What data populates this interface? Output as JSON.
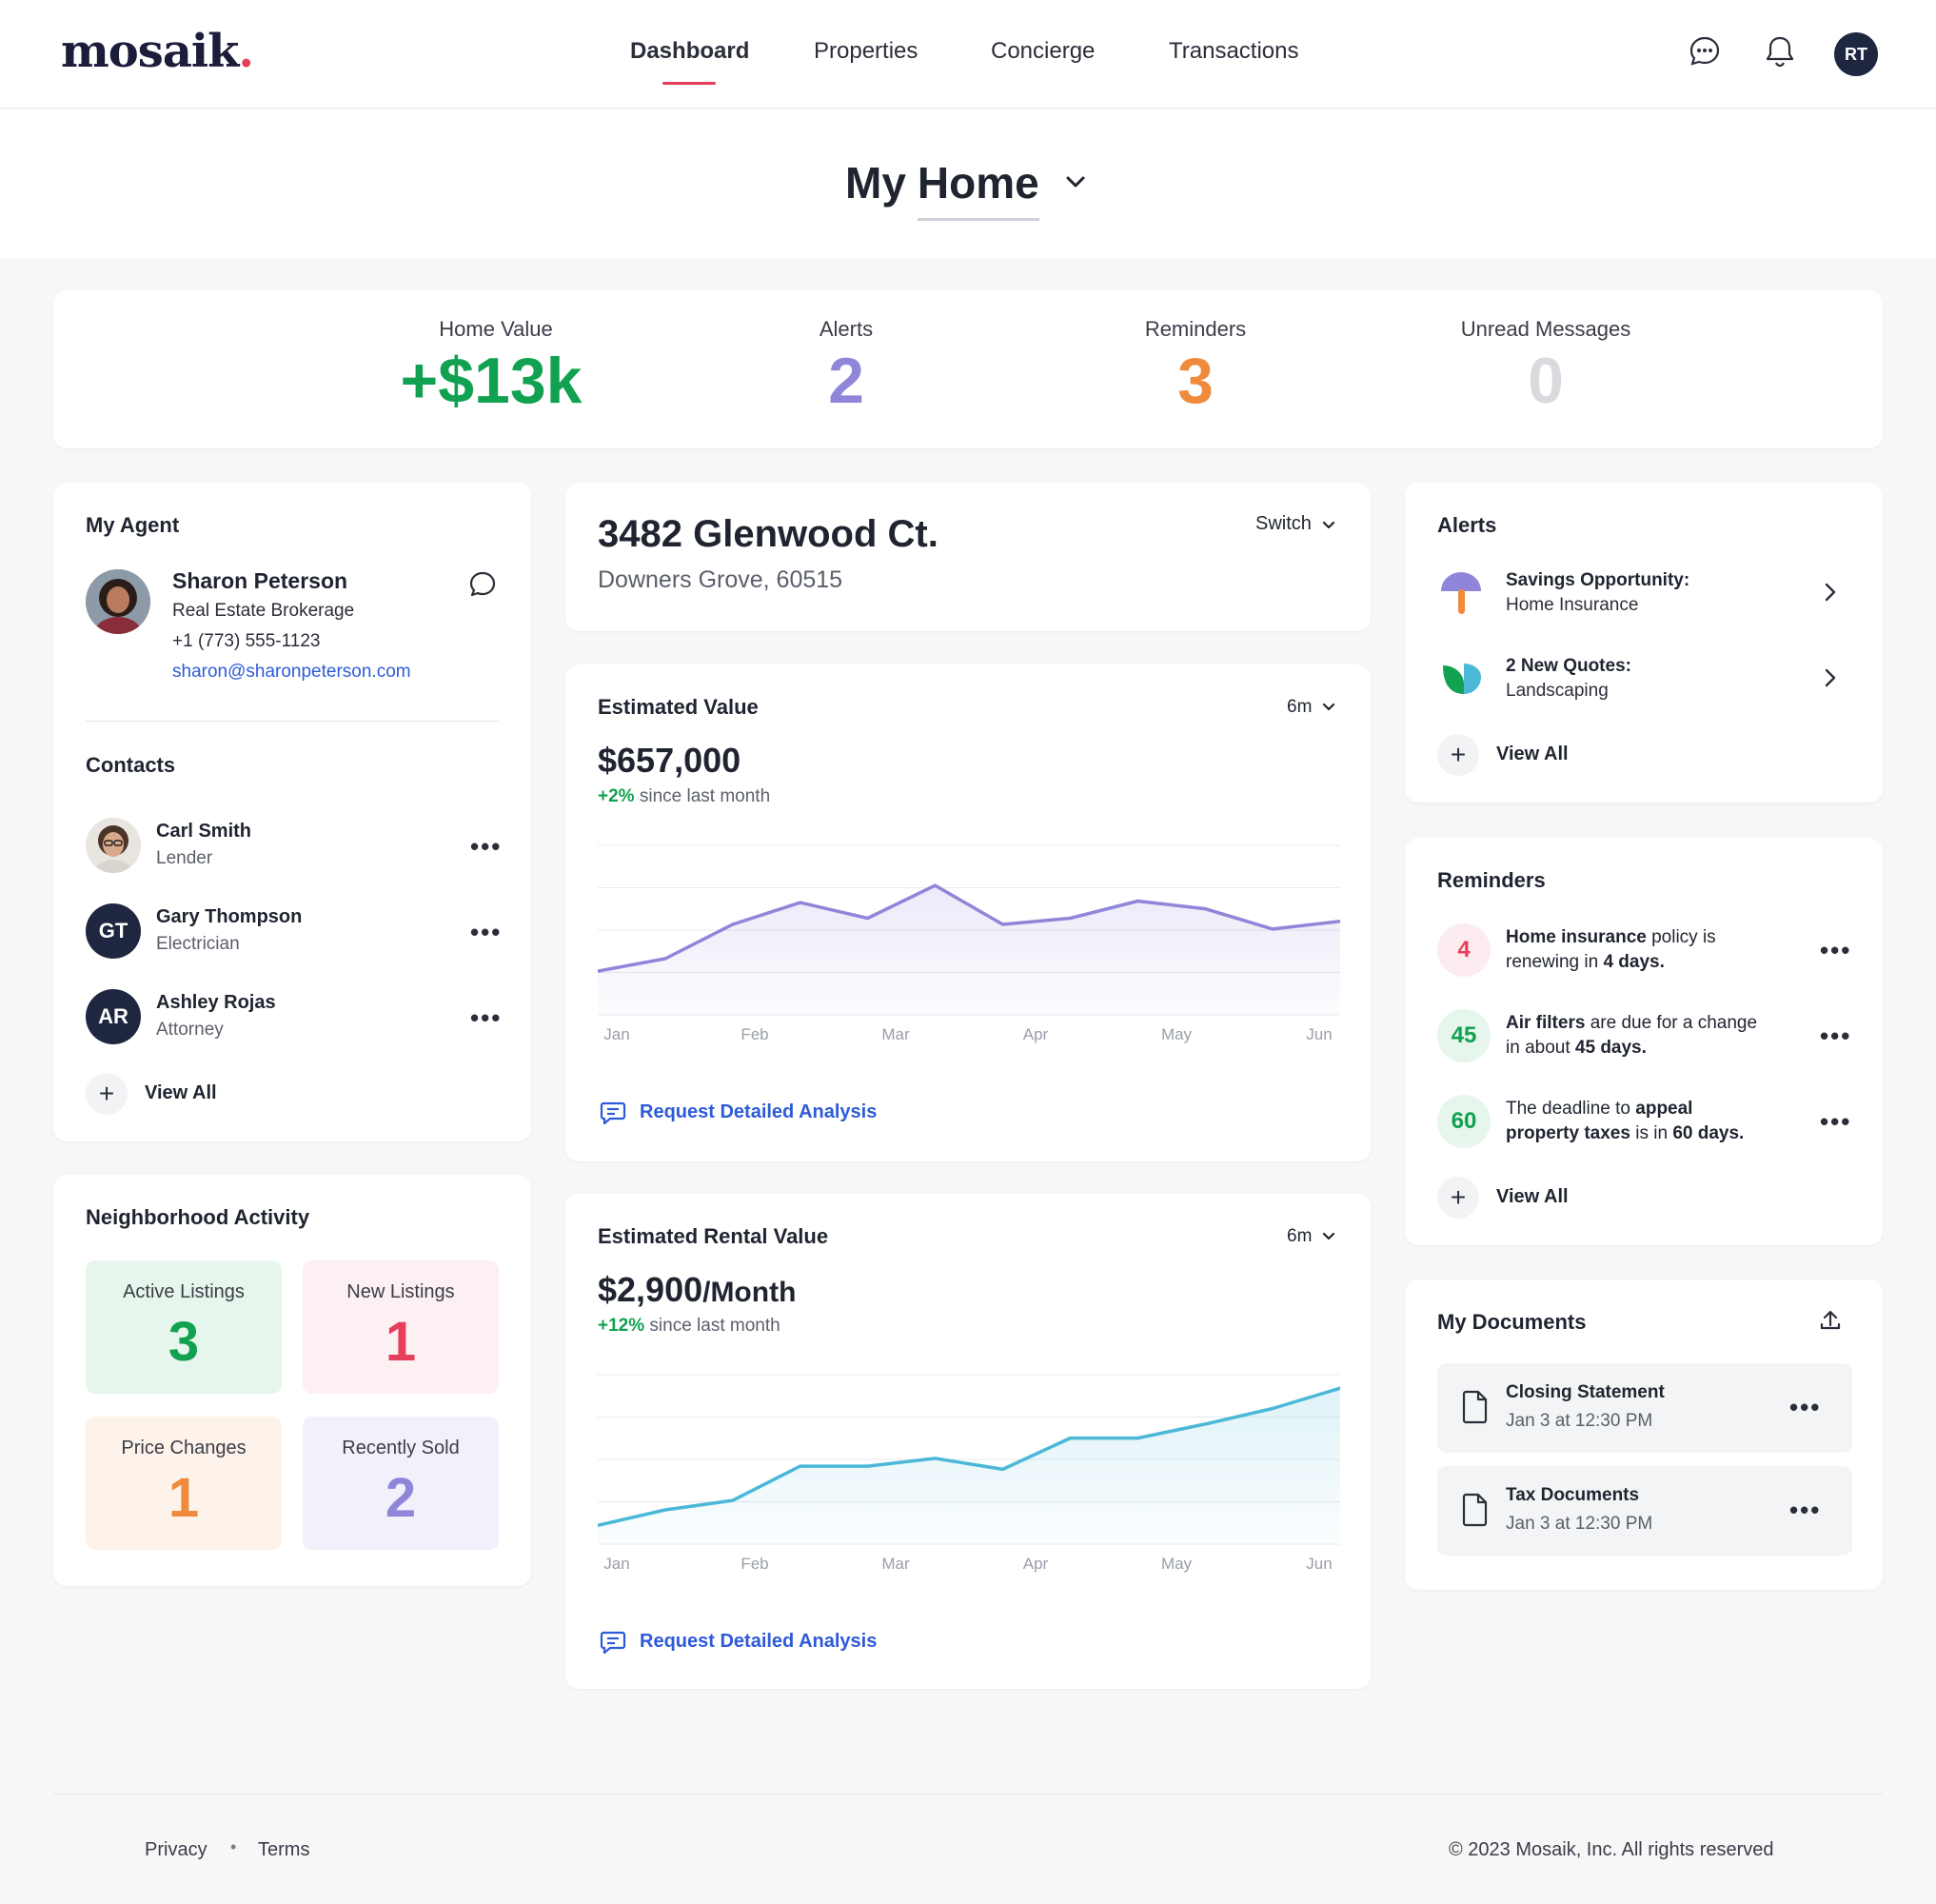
{
  "header": {
    "logo": "mosaik",
    "nav": [
      "Dashboard",
      "Properties",
      "Concierge",
      "Transactions"
    ],
    "active_nav": "Dashboard",
    "user_initials": "RT"
  },
  "page": {
    "title_prefix": "My",
    "title_selected": "Home"
  },
  "summary": [
    {
      "label": "Home Value",
      "value": "+$13k",
      "color": "#12a150"
    },
    {
      "label": "Alerts",
      "value": "2",
      "color": "#8f86d9"
    },
    {
      "label": "Reminders",
      "value": "3",
      "color": "#f08a3c"
    },
    {
      "label": "Unread Messages",
      "value": "0",
      "color": "#d9dade"
    }
  ],
  "agent": {
    "section_title": "My Agent",
    "name": "Sharon Peterson",
    "company": "Real Estate Brokerage",
    "phone": "+1 (773) 555-1123",
    "email": "sharon@sharonpeterson.com"
  },
  "contacts": {
    "section_title": "Contacts",
    "items": [
      {
        "name": "Carl Smith",
        "role": "Lender",
        "initials": ""
      },
      {
        "name": "Gary Thompson",
        "role": "Electrician",
        "initials": "GT"
      },
      {
        "name": "Ashley Rojas",
        "role": "Attorney",
        "initials": "AR"
      }
    ],
    "view_all": "View All"
  },
  "neighborhood": {
    "title": "Neighborhood Activity",
    "tiles": [
      {
        "label": "Active Listings",
        "value": "3",
        "bg": "#e6f6ec",
        "color": "#12a150"
      },
      {
        "label": "New Listings",
        "value": "1",
        "bg": "#fdf0f2",
        "color": "#e63e5b"
      },
      {
        "label": "Price Changes",
        "value": "1",
        "bg": "#fdf3ea",
        "color": "#f08a3c"
      },
      {
        "label": "Recently Sold",
        "value": "2",
        "bg": "#f1f0fb",
        "color": "#8f86d9"
      }
    ]
  },
  "property": {
    "address": "3482 Glenwood Ct.",
    "city": "Downers Grove, 60515",
    "switch_label": "Switch"
  },
  "estimated_value": {
    "title": "Estimated Value",
    "range": "6m",
    "value": "$657,000",
    "change": "+2%",
    "change_suffix": "since last month",
    "action": "Request Detailed Analysis"
  },
  "estimated_rental": {
    "title": "Estimated Rental Value",
    "range": "6m",
    "value": "$2,900",
    "value_suffix": "/Month",
    "change": "+12%",
    "change_suffix": "since last month",
    "action": "Request Detailed Analysis"
  },
  "chart_data": [
    {
      "type": "area",
      "x": [
        "Jan",
        "Feb",
        "Mar",
        "Apr",
        "May",
        "Jun"
      ],
      "series": [
        {
          "values": [
            0.28,
            0.36,
            0.58,
            0.72,
            0.62,
            0.83,
            0.58,
            0.62,
            0.73,
            0.68,
            0.55,
            0.6
          ]
        }
      ],
      "color": "#8f86d9",
      "grid": true
    },
    {
      "type": "area",
      "x": [
        "Jan",
        "Feb",
        "Mar",
        "Apr",
        "May",
        "Jun"
      ],
      "series": [
        {
          "values": [
            0.12,
            0.22,
            0.28,
            0.5,
            0.5,
            0.55,
            0.48,
            0.68,
            0.68,
            0.77,
            0.87,
            1.0
          ]
        }
      ],
      "color": "#4bb8d8",
      "grid": true
    }
  ],
  "alerts": {
    "title": "Alerts",
    "items": [
      {
        "title": "Savings Opportunity:",
        "subtitle": "Home Insurance",
        "icon": "umbrella-icon"
      },
      {
        "title": "2 New Quotes:",
        "subtitle": "Landscaping",
        "icon": "leaf-icon"
      }
    ],
    "view_all": "View All"
  },
  "reminders": {
    "title": "Reminders",
    "items": [
      {
        "badge": "4",
        "badge_bg": "#fdecef",
        "badge_color": "#e63e5b",
        "a": "Home insurance",
        "b": " policy is",
        "c": "renewing in ",
        "d": "4 days."
      },
      {
        "badge": "45",
        "badge_bg": "#e6f6ec",
        "badge_color": "#12a150",
        "a": "Air filters",
        "b": " are due for a change",
        "c": "in about ",
        "d": "45 days."
      },
      {
        "badge": "60",
        "badge_bg": "#e6f6ec",
        "badge_color": "#12a150",
        "a": "The deadline to ",
        "b": "appeal",
        "c": "property taxes",
        "d": " is in ",
        "e": "60 days."
      }
    ],
    "view_all": "View All"
  },
  "documents": {
    "title": "My Documents",
    "items": [
      {
        "name": "Closing Statement",
        "date": "Jan 3 at 12:30 PM"
      },
      {
        "name": "Tax Documents",
        "date": "Jan 3 at 12:30 PM"
      }
    ]
  },
  "footer": {
    "links": [
      "Privacy",
      "Terms"
    ],
    "copyright": "© 2023 Mosaik, Inc. All rights reserved"
  }
}
